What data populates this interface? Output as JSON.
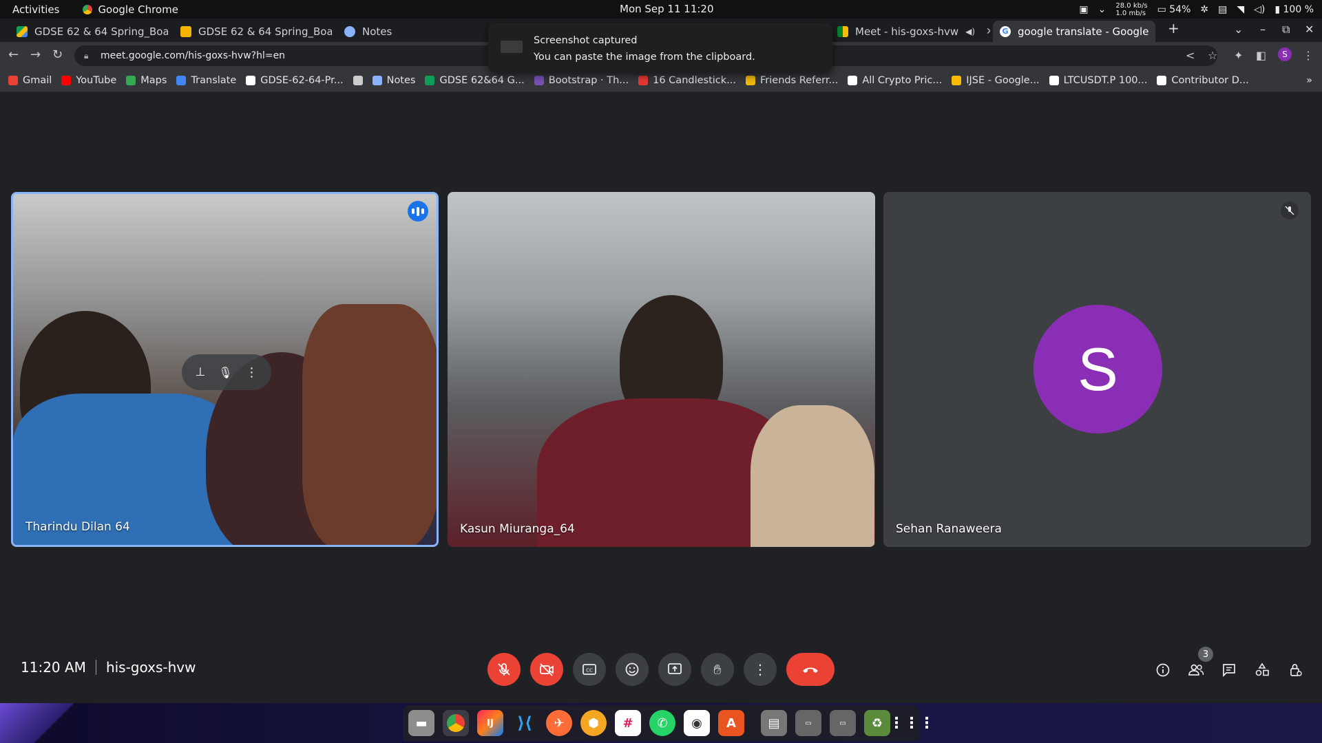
{
  "topbar": {
    "activities": "Activities",
    "app_name": "Google Chrome",
    "clock": "Mon Sep 11  11:20",
    "net_up": "28.0 kb/s",
    "net_down": "1.0 mb/s",
    "battery_pct": "54%",
    "volume_pct": "100 %"
  },
  "tabs": [
    {
      "label": "GDSE 62 & 64 Spring_Boar",
      "icon": "drive-icon"
    },
    {
      "label": "GDSE 62 & 64 Spring_Boar",
      "icon": "slides-icon"
    },
    {
      "label": "Notes",
      "icon": "notes-icon"
    },
    {
      "label": "Meet - his-goxs-hvw",
      "icon": "meet-icon"
    },
    {
      "label": "google translate - Google",
      "icon": "google-icon"
    }
  ],
  "toolbar": {
    "url": "meet.google.com/his-goxs-hvw?hl=en",
    "profile_initial": "S"
  },
  "bookmarks": [
    {
      "label": "Gmail",
      "color": "#ea4335"
    },
    {
      "label": "YouTube",
      "color": "#ff0000"
    },
    {
      "label": "Maps",
      "color": "#34a853"
    },
    {
      "label": "Translate",
      "color": "#4285f4"
    },
    {
      "label": "GDSE-62-64-Pr...",
      "color": "#ffffff"
    },
    {
      "label": "",
      "color": "#cccccc"
    },
    {
      "label": "Notes",
      "color": "#8ab4f8"
    },
    {
      "label": "GDSE 62&64 G...",
      "color": "#0f9d58"
    },
    {
      "label": "Bootstrap · Th...",
      "color": "#7952b3"
    },
    {
      "label": "16 Candlestick...",
      "color": "#e53935"
    },
    {
      "label": "Friends Referr...",
      "color": "#f0b90b"
    },
    {
      "label": "All Crypto Pric...",
      "color": "#ffffff"
    },
    {
      "label": "IJSE - Google...",
      "color": "#fbbc04"
    },
    {
      "label": "LTCUSDT.P 100...",
      "color": "#ffffff"
    },
    {
      "label": "Contributor D...",
      "color": "#ffffff"
    }
  ],
  "toast": {
    "title": "Screenshot captured",
    "body": "You can paste the image from the clipboard."
  },
  "meet": {
    "participants": [
      {
        "name": "Tharindu Dilan 64",
        "speaking": true
      },
      {
        "name": "Kasun Miuranga_64",
        "speaking": false
      },
      {
        "name": "Sehan Ranaweera",
        "avatar_initial": "S",
        "muted": true,
        "avatar_color": "#8a2fb5"
      }
    ],
    "time": "11:20 AM",
    "meeting_code": "his-goxs-hvw",
    "people_count": "3",
    "colors": {
      "accent": "#8ab4f8",
      "danger": "#ea4335",
      "button_bg": "#3c4043"
    }
  }
}
